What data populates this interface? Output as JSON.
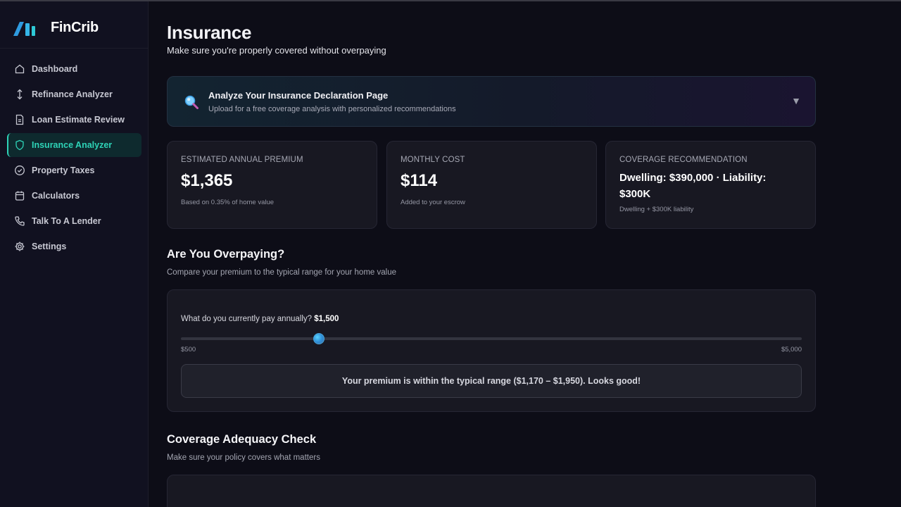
{
  "app": {
    "name": "FinCrib"
  },
  "sidebar": {
    "items": [
      {
        "label": "Dashboard",
        "icon": "home-icon",
        "active": false
      },
      {
        "label": "Refinance Analyzer",
        "icon": "arrows-vertical-icon",
        "active": false
      },
      {
        "label": "Loan Estimate Review",
        "icon": "document-icon",
        "active": false
      },
      {
        "label": "Insurance Analyzer",
        "icon": "shield-icon",
        "active": true
      },
      {
        "label": "Property Taxes",
        "icon": "check-circle-icon",
        "active": false
      },
      {
        "label": "Calculators",
        "icon": "calendar-icon",
        "active": false
      },
      {
        "label": "Talk To A Lender",
        "icon": "phone-icon",
        "active": false
      },
      {
        "label": "Settings",
        "icon": "gear-icon",
        "active": false
      }
    ]
  },
  "page": {
    "title": "Insurance",
    "subtitle": "Make sure you're properly covered without overpaying"
  },
  "banner": {
    "icon": "magnifier-icon",
    "title": "Analyze Your Insurance Declaration Page",
    "subtitle": "Upload for a free coverage analysis with personalized recommendations",
    "caret": "▼"
  },
  "cards": [
    {
      "label": "ESTIMATED ANNUAL PREMIUM",
      "value": "$1,365",
      "note": "Based on 0.35% of home value"
    },
    {
      "label": "MONTHLY COST",
      "value": "$114",
      "note": "Added to your escrow"
    },
    {
      "label": "COVERAGE RECOMMENDATION",
      "value": "Dwelling: $390,000 · Liability: $300K",
      "note": "Dwelling + $300K liability"
    }
  ],
  "overpaying": {
    "title": "Are You Overpaying?",
    "subtitle": "Compare your premium to the typical range for your home value",
    "question": "What do you currently pay annually?",
    "current_value": "$1,500",
    "slider": {
      "min": 500,
      "max": 5000,
      "value": 1500,
      "min_label": "$500",
      "max_label": "$5,000"
    },
    "result": "Your premium is within the typical range ($1,170 – $1,950). Looks good!"
  },
  "coverage": {
    "title": "Coverage Adequacy Check",
    "subtitle": "Make sure your policy covers what matters"
  },
  "colors": {
    "accent": "#2ed3b7",
    "background": "#0d0d17",
    "sidebar": "#111120",
    "card": "#181822"
  }
}
